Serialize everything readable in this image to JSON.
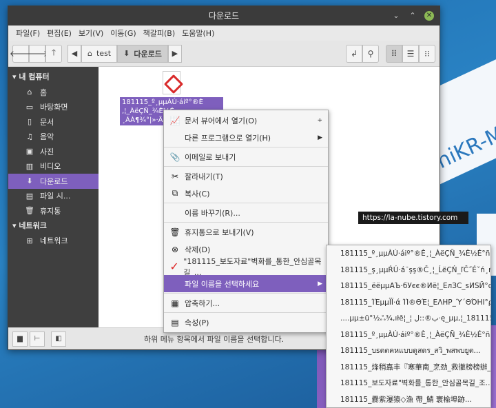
{
  "window": {
    "title": "다운로드",
    "controls": {
      "minimize": "⌄",
      "maximize": "⌃",
      "close": "✕"
    }
  },
  "menubar": [
    "파일(F)",
    "편집(E)",
    "보기(V)",
    "이동(G)",
    "책갈피(B)",
    "도움말(H)"
  ],
  "toolbar": {
    "breadcrumb": [
      "test",
      "다운로드"
    ]
  },
  "sidebar": {
    "computer_header": "내 컴퓨터",
    "computer_items": [
      {
        "label": "홈",
        "icon": "home-icon"
      },
      {
        "label": "바탕화면",
        "icon": "desktop-icon"
      },
      {
        "label": "문서",
        "icon": "documents-icon"
      },
      {
        "label": "음악",
        "icon": "music-icon"
      },
      {
        "label": "사진",
        "icon": "pictures-icon"
      },
      {
        "label": "비디오",
        "icon": "video-icon"
      },
      {
        "label": "다운로드",
        "icon": "download-icon"
      },
      {
        "label": "파일 시...",
        "icon": "filesystem-icon"
      },
      {
        "label": "휴지통",
        "icon": "trash-icon"
      }
    ],
    "network_header": "네트워크",
    "network_items": [
      {
        "label": "네트워크",
        "icon": "network-icon"
      }
    ]
  },
  "file": {
    "name": "181115_º¸µµÀÚ·áiº°®È ,¦_ÀëÇÑ_¾È½É ¸ÁÀ¶¾°|»·Ã¿ë..."
  },
  "context_menu": [
    {
      "label": "문서 뷰어에서 열기(O)",
      "icon": "viewer-icon",
      "suffix": "+"
    },
    {
      "label": "다른 프로그램으로 열기(H)",
      "icon": "",
      "suffix": "▶"
    },
    {
      "sep": true
    },
    {
      "label": "이메일로 보내기",
      "icon": "email-icon",
      "suffix": ""
    },
    {
      "sep": true
    },
    {
      "label": "잘라내기(T)",
      "icon": "cut-icon",
      "suffix": ""
    },
    {
      "label": "복사(C)",
      "icon": "copy-icon",
      "suffix": ""
    },
    {
      "sep": true
    },
    {
      "label": "이름 바꾸기(R)...",
      "icon": "",
      "suffix": ""
    },
    {
      "sep": true
    },
    {
      "label": "휴지통으로 보내기(V)",
      "icon": "trash-icon",
      "suffix": ""
    },
    {
      "label": "삭제(D)",
      "icon": "delete-icon",
      "suffix": ""
    },
    {
      "label": "\"181115_보도자료\"벽화를_통한_안심골목길_...",
      "icon": "checkmark-icon",
      "suffix": ""
    },
    {
      "label": "파일 이름을 선택하세요",
      "icon": "",
      "suffix": "▶",
      "selected": true
    },
    {
      "sep": true
    },
    {
      "label": "압축하기...",
      "icon": "archive-icon",
      "suffix": ""
    },
    {
      "sep": true
    },
    {
      "label": "속성(P)",
      "icon": "properties-icon",
      "suffix": ""
    }
  ],
  "submenu": [
    "181115_º¸µµÀÚ·áiº°®È¸¦_ÀëÇÑ_¾È½É°ñ¸ñ...",
    "181115_ş¸µµŔÚ·á¨şş®Č¸¦_ĹëÇŃ_ľČ˝Éˇń¸ń±...",
    "181115_ёёµµАЪ·бУєє®Иё¦_ЕлЗС_ѕИЅЙ°с...",
    "181115_ΊΈμμΪΪ·ά  ΊΊ®ΘΈ¦_ΕΛΗΡ_Ύ΄ΘΌΗΙ°ρ...",
    "....µµ±ũ°½ஃ¾,ıłē¦_¦ ب®::ل·ę_µµ,¦_181115",
    "181115_º¸µµÀÚ·áiº°®È¸¦_ÀëÇÑ_¾È½É°ñ¸ñ...",
    "181115_บsตตคหแบบดูสดร_สวิ_พสพบยูต...",
    "181115_烽稍嘉丰『寒華南_烹劲_救徹榜榜辦_...",
    "181115_보도자료\"벽화를_통한_안심골목길_조...",
    "181115_爨紫瀑猿◇漁 帶_鯖 寰楡埠跡..."
  ],
  "tooltip": "https://la-nube.tistory.com",
  "statusbar": {
    "text": "하위 메뉴 항목에서 파일 이름을 선택합니다."
  },
  "desktop": {
    "text": "oniKR-M"
  }
}
